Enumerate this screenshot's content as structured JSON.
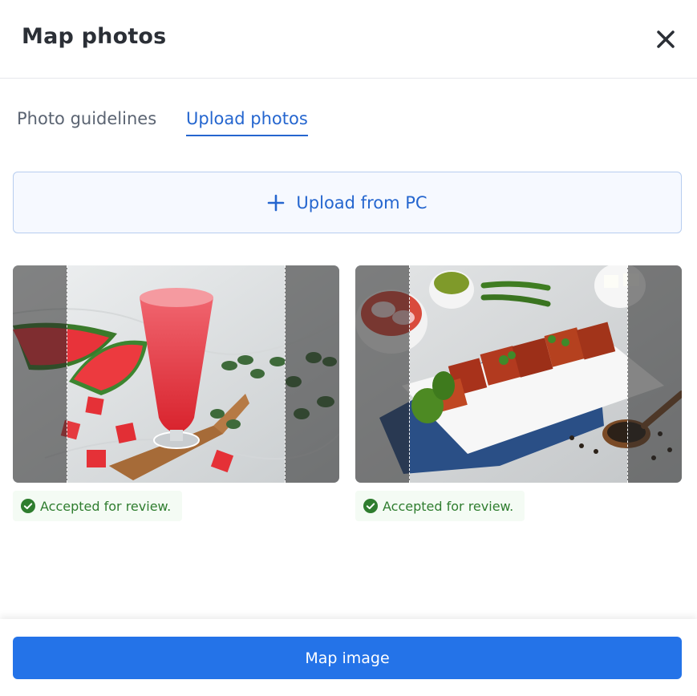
{
  "header": {
    "title": "Map photos",
    "close_icon": "close-icon"
  },
  "tabs": [
    {
      "label": "Photo guidelines",
      "active": false
    },
    {
      "label": "Upload photos",
      "active": true
    }
  ],
  "upload": {
    "icon": "plus-icon",
    "label": "Upload from PC"
  },
  "photos": [
    {
      "subject": "watermelon juice",
      "status_icon": "check-circle-icon",
      "status": "Accepted for review."
    },
    {
      "subject": "tandoori paneer tikka",
      "status_icon": "check-circle-icon",
      "status": "Accepted for review."
    }
  ],
  "footer": {
    "button_label": "Map image"
  },
  "colors": {
    "accent": "#2566cf",
    "primary_button": "#2473e8",
    "success": "#2f7d2f"
  }
}
